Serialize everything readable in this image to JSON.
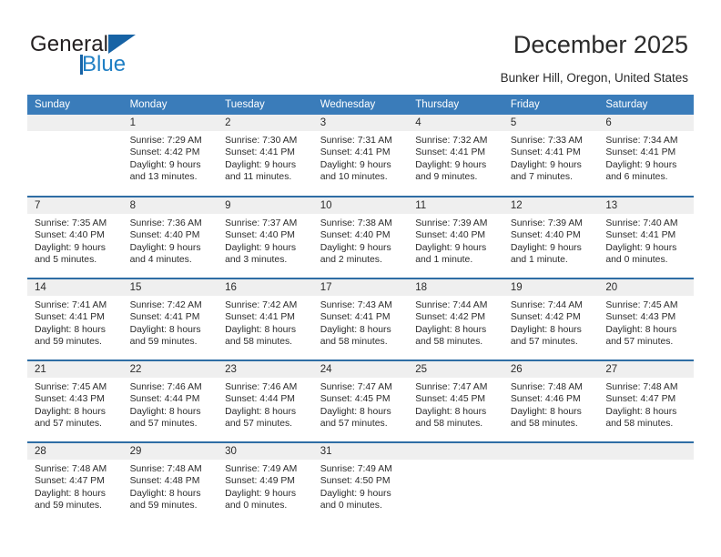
{
  "brand": {
    "name_part1": "General",
    "name_part2": "Blue",
    "accent_color": "#1763a5",
    "logo_icon": "triangle-flag-icon"
  },
  "header": {
    "title": "December 2025",
    "location": "Bunker Hill, Oregon, United States"
  },
  "calendar": {
    "header_bg": "#3a7cba",
    "daynum_bg": "#efefef",
    "separator_color": "#2e6da4",
    "weekdays": [
      "Sunday",
      "Monday",
      "Tuesday",
      "Wednesday",
      "Thursday",
      "Friday",
      "Saturday"
    ],
    "weeks": [
      [
        {
          "day": "",
          "lines": []
        },
        {
          "day": "1",
          "lines": [
            "Sunrise: 7:29 AM",
            "Sunset: 4:42 PM",
            "Daylight: 9 hours",
            "and 13 minutes."
          ]
        },
        {
          "day": "2",
          "lines": [
            "Sunrise: 7:30 AM",
            "Sunset: 4:41 PM",
            "Daylight: 9 hours",
            "and 11 minutes."
          ]
        },
        {
          "day": "3",
          "lines": [
            "Sunrise: 7:31 AM",
            "Sunset: 4:41 PM",
            "Daylight: 9 hours",
            "and 10 minutes."
          ]
        },
        {
          "day": "4",
          "lines": [
            "Sunrise: 7:32 AM",
            "Sunset: 4:41 PM",
            "Daylight: 9 hours",
            "and 9 minutes."
          ]
        },
        {
          "day": "5",
          "lines": [
            "Sunrise: 7:33 AM",
            "Sunset: 4:41 PM",
            "Daylight: 9 hours",
            "and 7 minutes."
          ]
        },
        {
          "day": "6",
          "lines": [
            "Sunrise: 7:34 AM",
            "Sunset: 4:41 PM",
            "Daylight: 9 hours",
            "and 6 minutes."
          ]
        }
      ],
      [
        {
          "day": "7",
          "lines": [
            "Sunrise: 7:35 AM",
            "Sunset: 4:40 PM",
            "Daylight: 9 hours",
            "and 5 minutes."
          ]
        },
        {
          "day": "8",
          "lines": [
            "Sunrise: 7:36 AM",
            "Sunset: 4:40 PM",
            "Daylight: 9 hours",
            "and 4 minutes."
          ]
        },
        {
          "day": "9",
          "lines": [
            "Sunrise: 7:37 AM",
            "Sunset: 4:40 PM",
            "Daylight: 9 hours",
            "and 3 minutes."
          ]
        },
        {
          "day": "10",
          "lines": [
            "Sunrise: 7:38 AM",
            "Sunset: 4:40 PM",
            "Daylight: 9 hours",
            "and 2 minutes."
          ]
        },
        {
          "day": "11",
          "lines": [
            "Sunrise: 7:39 AM",
            "Sunset: 4:40 PM",
            "Daylight: 9 hours",
            "and 1 minute."
          ]
        },
        {
          "day": "12",
          "lines": [
            "Sunrise: 7:39 AM",
            "Sunset: 4:40 PM",
            "Daylight: 9 hours",
            "and 1 minute."
          ]
        },
        {
          "day": "13",
          "lines": [
            "Sunrise: 7:40 AM",
            "Sunset: 4:41 PM",
            "Daylight: 9 hours",
            "and 0 minutes."
          ]
        }
      ],
      [
        {
          "day": "14",
          "lines": [
            "Sunrise: 7:41 AM",
            "Sunset: 4:41 PM",
            "Daylight: 8 hours",
            "and 59 minutes."
          ]
        },
        {
          "day": "15",
          "lines": [
            "Sunrise: 7:42 AM",
            "Sunset: 4:41 PM",
            "Daylight: 8 hours",
            "and 59 minutes."
          ]
        },
        {
          "day": "16",
          "lines": [
            "Sunrise: 7:42 AM",
            "Sunset: 4:41 PM",
            "Daylight: 8 hours",
            "and 58 minutes."
          ]
        },
        {
          "day": "17",
          "lines": [
            "Sunrise: 7:43 AM",
            "Sunset: 4:41 PM",
            "Daylight: 8 hours",
            "and 58 minutes."
          ]
        },
        {
          "day": "18",
          "lines": [
            "Sunrise: 7:44 AM",
            "Sunset: 4:42 PM",
            "Daylight: 8 hours",
            "and 58 minutes."
          ]
        },
        {
          "day": "19",
          "lines": [
            "Sunrise: 7:44 AM",
            "Sunset: 4:42 PM",
            "Daylight: 8 hours",
            "and 57 minutes."
          ]
        },
        {
          "day": "20",
          "lines": [
            "Sunrise: 7:45 AM",
            "Sunset: 4:43 PM",
            "Daylight: 8 hours",
            "and 57 minutes."
          ]
        }
      ],
      [
        {
          "day": "21",
          "lines": [
            "Sunrise: 7:45 AM",
            "Sunset: 4:43 PM",
            "Daylight: 8 hours",
            "and 57 minutes."
          ]
        },
        {
          "day": "22",
          "lines": [
            "Sunrise: 7:46 AM",
            "Sunset: 4:44 PM",
            "Daylight: 8 hours",
            "and 57 minutes."
          ]
        },
        {
          "day": "23",
          "lines": [
            "Sunrise: 7:46 AM",
            "Sunset: 4:44 PM",
            "Daylight: 8 hours",
            "and 57 minutes."
          ]
        },
        {
          "day": "24",
          "lines": [
            "Sunrise: 7:47 AM",
            "Sunset: 4:45 PM",
            "Daylight: 8 hours",
            "and 57 minutes."
          ]
        },
        {
          "day": "25",
          "lines": [
            "Sunrise: 7:47 AM",
            "Sunset: 4:45 PM",
            "Daylight: 8 hours",
            "and 58 minutes."
          ]
        },
        {
          "day": "26",
          "lines": [
            "Sunrise: 7:48 AM",
            "Sunset: 4:46 PM",
            "Daylight: 8 hours",
            "and 58 minutes."
          ]
        },
        {
          "day": "27",
          "lines": [
            "Sunrise: 7:48 AM",
            "Sunset: 4:47 PM",
            "Daylight: 8 hours",
            "and 58 minutes."
          ]
        }
      ],
      [
        {
          "day": "28",
          "lines": [
            "Sunrise: 7:48 AM",
            "Sunset: 4:47 PM",
            "Daylight: 8 hours",
            "and 59 minutes."
          ]
        },
        {
          "day": "29",
          "lines": [
            "Sunrise: 7:48 AM",
            "Sunset: 4:48 PM",
            "Daylight: 8 hours",
            "and 59 minutes."
          ]
        },
        {
          "day": "30",
          "lines": [
            "Sunrise: 7:49 AM",
            "Sunset: 4:49 PM",
            "Daylight: 9 hours",
            "and 0 minutes."
          ]
        },
        {
          "day": "31",
          "lines": [
            "Sunrise: 7:49 AM",
            "Sunset: 4:50 PM",
            "Daylight: 9 hours",
            "and 0 minutes."
          ]
        },
        {
          "day": "",
          "lines": []
        },
        {
          "day": "",
          "lines": []
        },
        {
          "day": "",
          "lines": []
        }
      ]
    ]
  }
}
